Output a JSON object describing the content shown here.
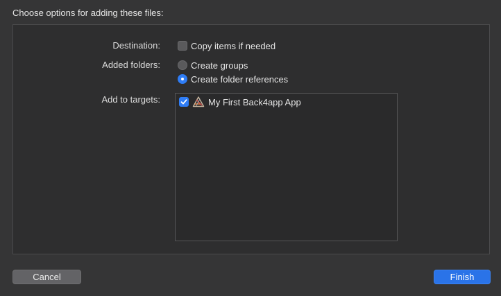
{
  "dialog": {
    "title": "Choose options for adding these files:"
  },
  "destination": {
    "label": "Destination:",
    "copy_items_label": "Copy items if needed",
    "copy_items_checked": false
  },
  "added_folders": {
    "label": "Added folders:",
    "options": [
      {
        "label": "Create groups",
        "selected": false
      },
      {
        "label": "Create folder references",
        "selected": true
      }
    ]
  },
  "targets": {
    "label": "Add to targets:",
    "items": [
      {
        "name": "My First Back4app App",
        "checked": true,
        "icon": "xcode-app-icon"
      }
    ]
  },
  "buttons": {
    "cancel_label": "Cancel",
    "finish_label": "Finish"
  },
  "colors": {
    "accent": "#2f7df6",
    "background": "#353536",
    "panel": "#2e2e2f"
  }
}
